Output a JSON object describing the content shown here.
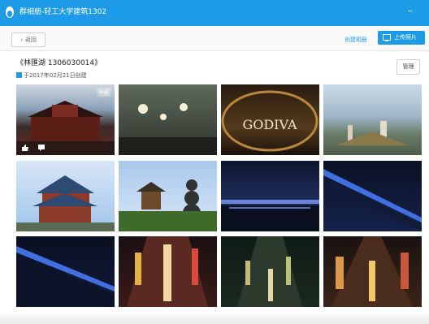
{
  "window": {
    "title": "群相册-轻工大学建筑1302",
    "minimize_label": "–"
  },
  "toolbar": {
    "back_label": "返回",
    "create_album_label": "创建相册",
    "upload_label": "上传照片"
  },
  "album": {
    "title": "《林匯湖 1306030014》",
    "created": "于2017年02月21日创建",
    "manage_label": "管理"
  },
  "photos": [
    {
      "label": "yellow-crane-tower-night",
      "tag": "举报"
    },
    {
      "label": "street-trees-lights"
    },
    {
      "label": "godiva-storefront",
      "text": "GODIVA"
    },
    {
      "label": "city-skyline-aerial"
    },
    {
      "label": "yellow-crane-tower-day"
    },
    {
      "label": "pagoda-park"
    },
    {
      "label": "bridge-night-1"
    },
    {
      "label": "bridge-night-2"
    },
    {
      "label": "bridge-night-3"
    },
    {
      "label": "night-market-1"
    },
    {
      "label": "night-market-2"
    },
    {
      "label": "night-market-3"
    }
  ],
  "colors": {
    "accent": "#1e9be6"
  }
}
